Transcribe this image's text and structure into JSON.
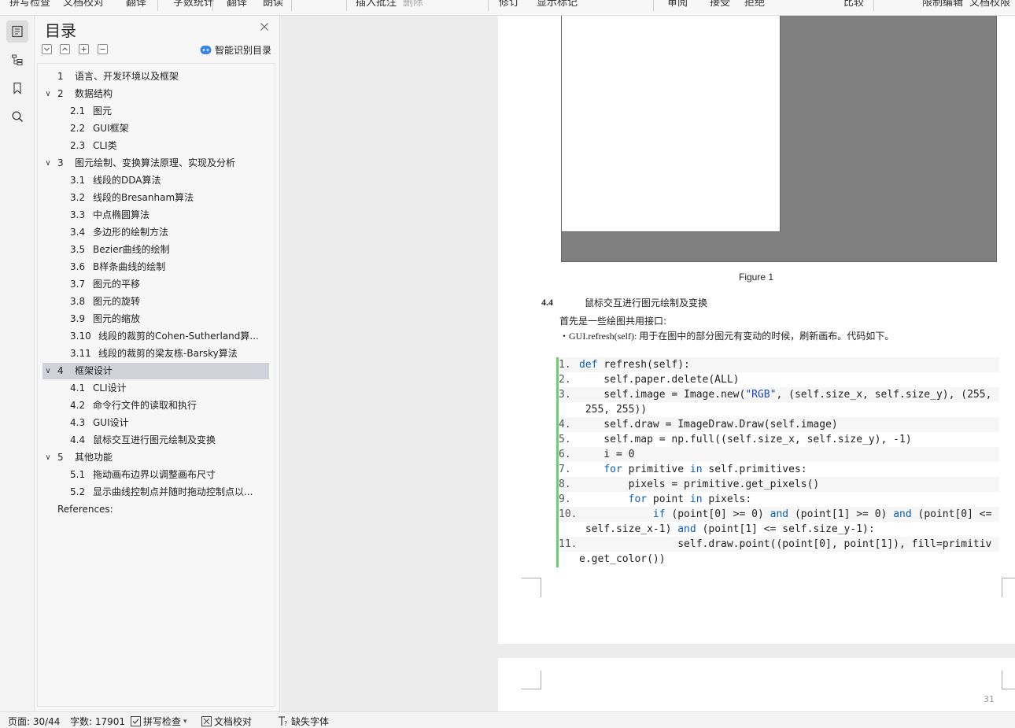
{
  "toolbar": {
    "items": [
      {
        "label": "拼写检查",
        "dim": false
      },
      {
        "label": "文档校对",
        "dim": false
      },
      {
        "label": "翻译",
        "dim": false
      },
      {
        "label": "字数统计",
        "dim": false
      },
      {
        "label": "翻译",
        "dim": false
      },
      {
        "label": "朗读",
        "dim": false
      },
      {
        "label": "插入批注",
        "dim": false
      },
      {
        "label": "删除",
        "dim": true
      },
      {
        "label": "修订",
        "dim": false
      },
      {
        "label": "显示标记",
        "dim": false
      },
      {
        "label": "审阅",
        "dim": false
      },
      {
        "label": "接受",
        "dim": false
      },
      {
        "label": "拒绝",
        "dim": false
      },
      {
        "label": "比较",
        "dim": false
      },
      {
        "label": "限制编辑",
        "dim": false
      },
      {
        "label": "文档权限",
        "dim": false
      }
    ]
  },
  "rail": {
    "icons": [
      "toc-icon",
      "outline-icon",
      "bookmark-icon",
      "search-icon"
    ]
  },
  "toc": {
    "title": "目录",
    "smart_label": "智能识别目录",
    "items": [
      {
        "num": "1",
        "text": "语言、开发环境以及框架",
        "level": 1,
        "chevron": false,
        "selected": false
      },
      {
        "num": "2",
        "text": "数据结构",
        "level": 1,
        "chevron": true,
        "selected": false
      },
      {
        "num": "2.1",
        "text": "图元",
        "level": 2,
        "chevron": false,
        "selected": false
      },
      {
        "num": "2.2",
        "text": "GUI框架",
        "level": 2,
        "chevron": false,
        "selected": false
      },
      {
        "num": "2.3",
        "text": "CLI类",
        "level": 2,
        "chevron": false,
        "selected": false
      },
      {
        "num": "3",
        "text": "图元绘制、变换算法原理、实现及分析",
        "level": 1,
        "chevron": true,
        "selected": false
      },
      {
        "num": "3.1",
        "text": "线段的DDA算法",
        "level": 2,
        "chevron": false,
        "selected": false
      },
      {
        "num": "3.2",
        "text": "线段的Bresanham算法",
        "level": 2,
        "chevron": false,
        "selected": false
      },
      {
        "num": "3.3",
        "text": "中点椭圆算法",
        "level": 2,
        "chevron": false,
        "selected": false
      },
      {
        "num": "3.4",
        "text": "多边形的绘制方法",
        "level": 2,
        "chevron": false,
        "selected": false
      },
      {
        "num": "3.5",
        "text": "Bezier曲线的绘制",
        "level": 2,
        "chevron": false,
        "selected": false
      },
      {
        "num": "3.6",
        "text": "B样条曲线的绘制",
        "level": 2,
        "chevron": false,
        "selected": false
      },
      {
        "num": "3.7",
        "text": "图元的平移",
        "level": 2,
        "chevron": false,
        "selected": false
      },
      {
        "num": "3.8",
        "text": "图元的旋转",
        "level": 2,
        "chevron": false,
        "selected": false
      },
      {
        "num": "3.9",
        "text": "图元的缩放",
        "level": 2,
        "chevron": false,
        "selected": false
      },
      {
        "num": "3.10",
        "text": "线段的裁剪的Cohen-Sutherland算...",
        "level": 2,
        "chevron": false,
        "selected": false
      },
      {
        "num": "3.11",
        "text": "线段的裁剪的梁友栋-Barsky算法",
        "level": 2,
        "chevron": false,
        "selected": false
      },
      {
        "num": "4",
        "text": "框架设计",
        "level": 1,
        "chevron": true,
        "selected": true
      },
      {
        "num": "4.1",
        "text": "CLI设计",
        "level": 2,
        "chevron": false,
        "selected": false
      },
      {
        "num": "4.2",
        "text": "命令行文件的读取和执行",
        "level": 2,
        "chevron": false,
        "selected": false
      },
      {
        "num": "4.3",
        "text": "GUI设计",
        "level": 2,
        "chevron": false,
        "selected": false
      },
      {
        "num": "4.4",
        "text": "鼠标交互进行图元绘制及变换",
        "level": 2,
        "chevron": false,
        "selected": false
      },
      {
        "num": "5",
        "text": "其他功能",
        "level": 1,
        "chevron": true,
        "selected": false
      },
      {
        "num": "5.1",
        "text": "拖动画布边界以调整画布尺寸",
        "level": 2,
        "chevron": false,
        "selected": false
      },
      {
        "num": "5.2",
        "text": "显示曲线控制点并随时拖动控制点以...",
        "level": 2,
        "chevron": false,
        "selected": false
      },
      {
        "num": "",
        "text": "References:",
        "level": 0,
        "chevron": false,
        "selected": false
      }
    ]
  },
  "document": {
    "figure_caption": "Figure 1",
    "section_num": "4.4",
    "section_title": "鼠标交互进行图元绘制及变换",
    "intro_line1": "首先是一些绘图共用接口:",
    "intro_line2": "・GUI.refresh(self): 用于在图中的部分图元有变动的时候，刷新画布。代码如下。",
    "code_lines": [
      {
        "ln": "1.",
        "html": "<span class=\"kw\">def</span> refresh(self):"
      },
      {
        "ln": "2.",
        "html": "    self.paper.delete(ALL)"
      },
      {
        "ln": "3.",
        "html": "    self.image = Image.new(<span class=\"str\">\"RGB\"</span>, (self.size_x, self.size_y), (255,"
      },
      {
        "ln": "",
        "html": " 255, 255))"
      },
      {
        "ln": "4.",
        "html": "    self.draw = ImageDraw.Draw(self.image)"
      },
      {
        "ln": "5.",
        "html": "    self.map = np.full((self.size_x, self.size_y), -1)"
      },
      {
        "ln": "6.",
        "html": "    i = 0"
      },
      {
        "ln": "7.",
        "html": "    <span class=\"kw\">for</span> primitive <span class=\"kw\">in</span> self.primitives:"
      },
      {
        "ln": "8.",
        "html": "        pixels = primitive.get_pixels()"
      },
      {
        "ln": "9.",
        "html": "        <span class=\"kw\">for</span> point <span class=\"kw\">in</span> pixels:"
      },
      {
        "ln": "10.",
        "html": "            <span class=\"kw\">if</span> (point[0] >= 0) <span class=\"kw\">and</span> (point[1] >= 0) <span class=\"kw\">and</span> (point[0] <="
      },
      {
        "ln": "",
        "html": " self.size_x-1) <span class=\"kw\">and</span> (point[1] <= self.size_y-1):"
      },
      {
        "ln": "11.",
        "html": "                self.draw.point((point[0], point[1]), fill=primitiv"
      },
      {
        "ln": "",
        "html": "e.get_color())"
      }
    ],
    "page_number": "31"
  },
  "status": {
    "page": "页面: 30/44",
    "words": "字数: 17901",
    "spell": "拼写检查",
    "proof": "文档校对",
    "missing_font": "缺失字体"
  }
}
